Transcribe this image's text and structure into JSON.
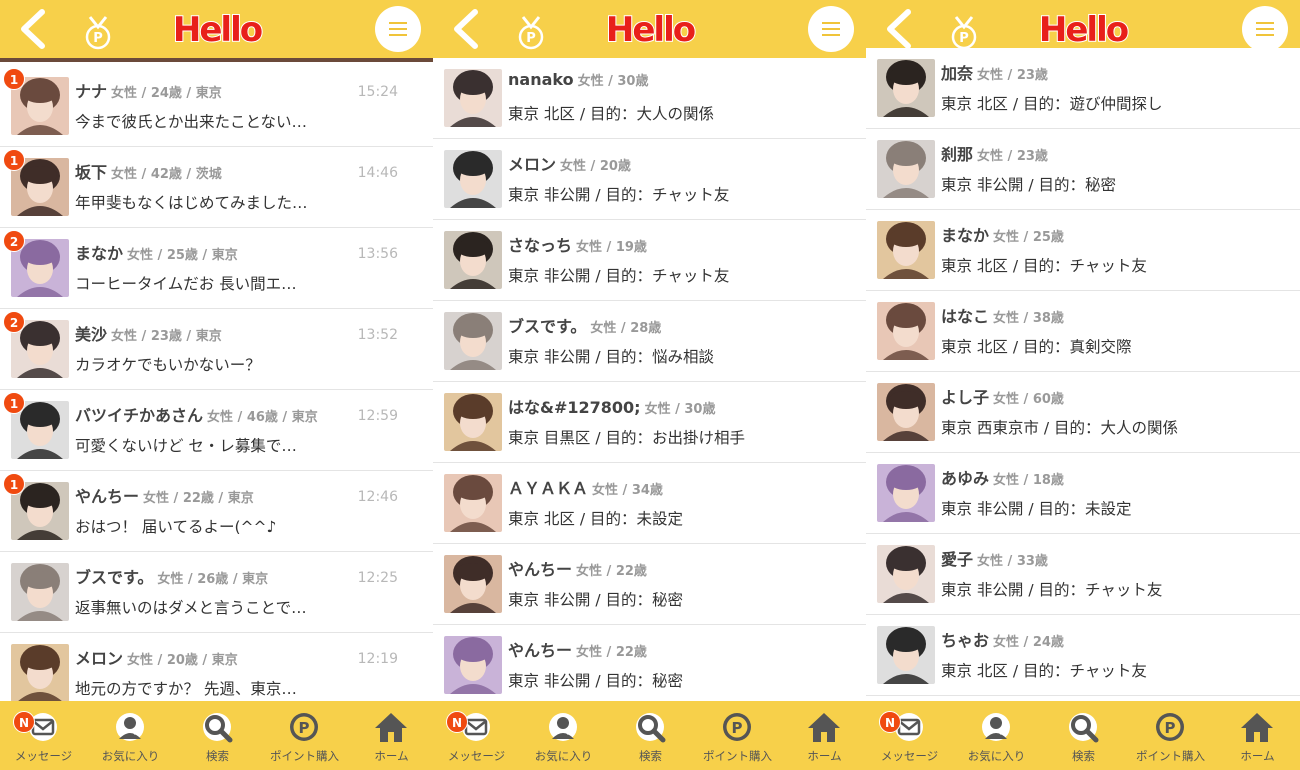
{
  "app": {
    "logo_text": "Hello",
    "colors": {
      "header": "#f7d04a",
      "logo": "#e8201a",
      "badge": "#f04a10"
    }
  },
  "icons": [
    "back-arrow-icon",
    "medal-p-icon",
    "hamburger-menu-icon"
  ],
  "footer": {
    "tabs": [
      {
        "label": "メッセージ",
        "icon": "message-envelope-icon",
        "badge": "N"
      },
      {
        "label": "お気に入り",
        "icon": "favorite-user-icon"
      },
      {
        "label": "検索",
        "icon": "search-icon"
      },
      {
        "label": "ポイント購入",
        "icon": "point-coin-icon"
      },
      {
        "label": "ホーム",
        "icon": "home-icon"
      }
    ]
  },
  "messages": [
    {
      "name": "ナナ",
      "meta": "女性 / 24歳 / 東京",
      "text": "今まで彼氏とか出来たことない…",
      "time": "15:24",
      "badge": "1"
    },
    {
      "name": "坂下",
      "meta": "女性 / 42歳 / 茨城",
      "text": "年甲斐もなくはじめてみました…",
      "time": "14:46",
      "badge": "1"
    },
    {
      "name": "まなか",
      "meta": "女性 / 25歳 / 東京",
      "text": "コーヒータイムだお 長い間エ…",
      "time": "13:56",
      "badge": "2"
    },
    {
      "name": "美沙",
      "meta": "女性 / 23歳 / 東京",
      "text": "カラオケでもいかないー？",
      "time": "13:52",
      "badge": "2"
    },
    {
      "name": "バツイチかあさん",
      "meta": "女性 / 46歳 / 東京",
      "text": "可愛くないけど セ・レ募集で…",
      "time": "12:59",
      "badge": "1"
    },
    {
      "name": "やんちー",
      "meta": "女性 / 22歳 / 東京",
      "text": "おはつ！ 届いてるよー(^^♪",
      "time": "12:46",
      "badge": "1"
    },
    {
      "name": "ブスです。",
      "meta": "女性 / 26歳 / 東京",
      "text": "返事無いのはダメと言うことで…",
      "time": "12:25",
      "badge": ""
    },
    {
      "name": "メロン",
      "meta": "女性 / 20歳 / 東京",
      "text": "地元の方ですか？ 先週、東京…",
      "time": "12:19",
      "badge": ""
    }
  ],
  "users_a": [
    {
      "name": "nanako",
      "meta": "女性 / 30歳",
      "text": "東京 北区 / 目的：大人の関係"
    },
    {
      "name": "メロン",
      "meta": "女性 / 20歳",
      "text": "東京 非公開 / 目的：チャット友"
    },
    {
      "name": "さなっち",
      "meta": "女性 / 19歳",
      "text": "東京 非公開 / 目的：チャット友"
    },
    {
      "name": "ブスです。",
      "meta": "女性 / 28歳",
      "text": "東京 非公開 / 目的：悩み相談"
    },
    {
      "name": "はな&#127800;",
      "meta": "女性 / 30歳",
      "text": "東京 目黒区 / 目的：お出掛け相手"
    },
    {
      "name": "ＡＹＡＫＡ",
      "meta": "女性 / 34歳",
      "text": "東京 北区 / 目的：未設定"
    },
    {
      "name": "やんちー",
      "meta": "女性 / 22歳",
      "text": "東京 非公開 / 目的：秘密"
    },
    {
      "name": "やんちー",
      "meta": "女性 / 22歳",
      "text": "東京 非公開 / 目的：秘密"
    }
  ],
  "users_b": [
    {
      "name": "加奈",
      "meta": "女性 / 23歳",
      "text": "東京 北区 / 目的：遊び仲間探し"
    },
    {
      "name": "刹那",
      "meta": "女性 / 23歳",
      "text": "東京 非公開 / 目的：秘密"
    },
    {
      "name": "まなか",
      "meta": "女性 / 25歳",
      "text": "東京 北区 / 目的：チャット友"
    },
    {
      "name": "はなこ",
      "meta": "女性 / 38歳",
      "text": "東京 北区 / 目的：真剣交際"
    },
    {
      "name": "よし子",
      "meta": "女性 / 60歳",
      "text": "東京 西東京市 / 目的：大人の関係"
    },
    {
      "name": "あゆみ",
      "meta": "女性 / 18歳",
      "text": "東京 非公開 / 目的：未設定"
    },
    {
      "name": "愛子",
      "meta": "女性 / 33歳",
      "text": "東京 非公開 / 目的：チャット友"
    },
    {
      "name": "ちゃお",
      "meta": "女性 / 24歳",
      "text": "東京 北区 / 目的：チャット友"
    }
  ]
}
